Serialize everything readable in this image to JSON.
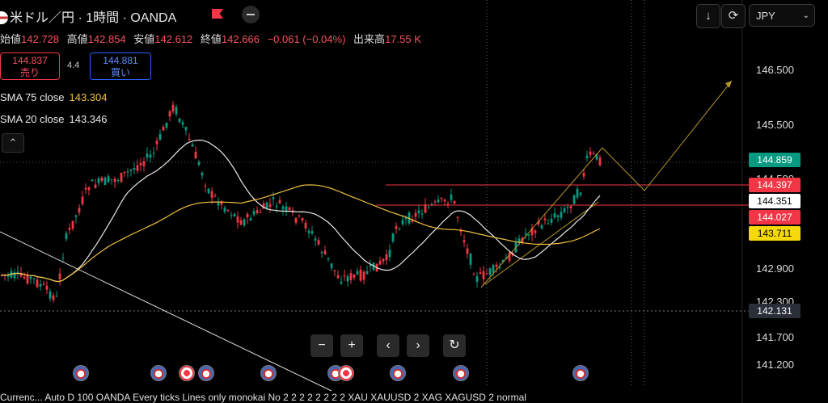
{
  "header": {
    "symbol_title": "米ドル／円 · 1時間 · OANDA"
  },
  "ohlc": {
    "open_label": "始値",
    "open": "142.728",
    "high_label": "高値",
    "high": "142.854",
    "low_label": "安値",
    "low": "142.612",
    "close_label": "終値",
    "close": "142.666",
    "change": "−0.061 (−0.04%)",
    "volume_label": "出来高",
    "volume": "17.55 K"
  },
  "trade": {
    "sell_price": "144.837",
    "sell_label": "売り",
    "spread": "4.4",
    "buy_price": "144.881",
    "buy_label": "買い"
  },
  "indicators": [
    {
      "label": "SMA 75 close",
      "value": "143.304",
      "color": "#f0c040"
    },
    {
      "label": "SMA 20 close",
      "value": "143.346",
      "color": "#e8e8e8"
    }
  ],
  "toolbar": {
    "collapse_icon": "chevron-up-icon",
    "download_icon": "arrow-down-icon",
    "refresh_icon": "refresh-icon",
    "currency": "JPY"
  },
  "price_axis": {
    "labels": [
      "146.500",
      "145.500",
      "144.500",
      "142.900",
      "142.300",
      "141.700",
      "141.200"
    ]
  },
  "price_tags": [
    {
      "value": "144.859",
      "bg": "#089981",
      "fg": "#ffffff"
    },
    {
      "value": "144.397",
      "bg": "#f23645",
      "fg": "#ffffff"
    },
    {
      "value": "144.351",
      "bg": "#ffffff",
      "fg": "#000000"
    },
    {
      "value": "144.027",
      "bg": "#f23645",
      "fg": "#ffffff"
    },
    {
      "value": "143.711",
      "bg": "#f5d90a",
      "fg": "#000000"
    },
    {
      "value": "142.131",
      "bg": "#2a2e39",
      "fg": "#ffffff"
    }
  ],
  "nav_controls": [
    "−",
    "+",
    "‹",
    "›",
    "↻"
  ],
  "bottom_bar": {
    "text": "Currenc... Auto D 100 OANDA Every ticks Lines only monokai No 2 2 2 2 2 2 2 2 XAU XAUUSD 2 XAG XAGUSD 2 normal"
  },
  "colors": {
    "up": "#089981",
    "down": "#f23645",
    "sma75": "#f0c040",
    "sma20": "#e8e8e8"
  }
}
